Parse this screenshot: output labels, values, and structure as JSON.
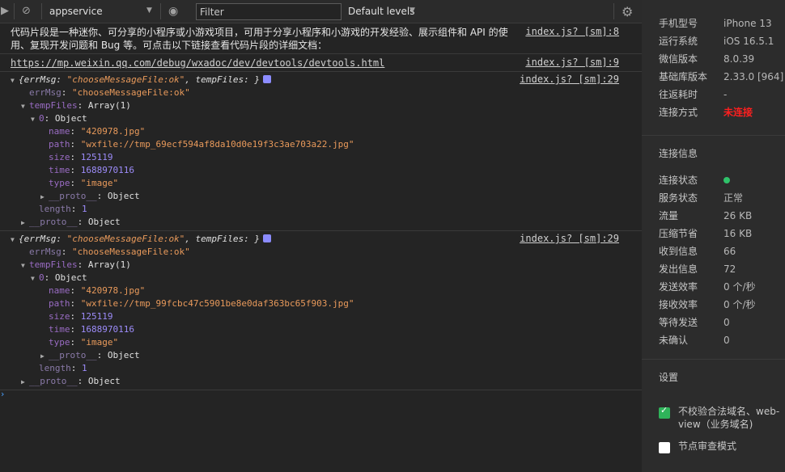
{
  "toolbar": {
    "run_icon": "play-square-icon",
    "clear_icon": "block-icon",
    "context": "appservice",
    "eye_icon": "eye-icon",
    "filter_placeholder": "Filter",
    "levels": "Default levels",
    "settings_icon": "gear-icon"
  },
  "messages": [
    {
      "text": "代码片段是一种迷你、可分享的小程序或小游戏项目，可用于分享小程序和小游戏的开发经验、展示组件和 API 的使用、复现开发问题和 Bug 等。可点击以下链接查看代码片段的详细文档：",
      "source": "index.js? [sm]:8"
    },
    {
      "text": "https://mp.weixin.qq.com/debug/wxadoc/dev/devtools/devtools.html",
      "source": "index.js? [sm]:9"
    }
  ],
  "objects": [
    {
      "summary_prefix": "{errMsg: ",
      "summary_errmsg": "\"chooseMessageFile:ok\"",
      "summary_mid": ", tempFiles: }",
      "source": "index.js? [sm]:29",
      "errMsg_key": "errMsg",
      "errMsg_val": "\"chooseMessageFile:ok\"",
      "tempFiles_key": "tempFiles",
      "tempFiles_val": "Array(1)",
      "item_key": "0",
      "item_val": "Object",
      "name_key": "name",
      "name_val": "\"420978.jpg\"",
      "path_key": "path",
      "path_val": "\"wxfile://tmp_69ecf594af8da10d0e19f3c3ae703a22.jpg\"",
      "size_key": "size",
      "size_val": "125119",
      "time_key": "time",
      "time_val": "1688970116",
      "type_key": "type",
      "type_val": "\"image\"",
      "proto_key": "__proto__",
      "proto_val": "Object",
      "length_key": "length",
      "length_val": "1"
    },
    {
      "summary_prefix": "{errMsg: ",
      "summary_errmsg": "\"chooseMessageFile:ok\"",
      "summary_mid": ", tempFiles: }",
      "source": "index.js? [sm]:29",
      "errMsg_key": "errMsg",
      "errMsg_val": "\"chooseMessageFile:ok\"",
      "tempFiles_key": "tempFiles",
      "tempFiles_val": "Array(1)",
      "item_key": "0",
      "item_val": "Object",
      "name_key": "name",
      "name_val": "\"420978.jpg\"",
      "path_key": "path",
      "path_val": "\"wxfile://tmp_99fcbc47c5901be8e0daf363bc65f903.jpg\"",
      "size_key": "size",
      "size_val": "125119",
      "time_key": "time",
      "time_val": "1688970116",
      "type_key": "type",
      "type_val": "\"image\"",
      "proto_key": "__proto__",
      "proto_val": "Object",
      "length_key": "length",
      "length_val": "1"
    }
  ],
  "prompt_icon": "chevron-right-icon",
  "device": [
    {
      "label": "手机型号",
      "value": "iPhone 13"
    },
    {
      "label": "运行系统",
      "value": "iOS 16.5.1"
    },
    {
      "label": "微信版本",
      "value": "8.0.39"
    },
    {
      "label": "基础库版本",
      "value": "2.33.0 [964]"
    },
    {
      "label": "往返耗时",
      "value": "-"
    },
    {
      "label": "连接方式",
      "value": "未连接"
    }
  ],
  "status_color_unconnected": "#ff1f1f",
  "conn_title": "连接信息",
  "conn": [
    {
      "label": "连接状态",
      "value": ""
    },
    {
      "label": "服务状态",
      "value": "正常"
    },
    {
      "label": "流量",
      "value": "26 KB"
    },
    {
      "label": "压缩节省",
      "value": "16 KB"
    },
    {
      "label": "收到信息",
      "value": "66"
    },
    {
      "label": "发出信息",
      "value": "72"
    },
    {
      "label": "发送效率",
      "value": "0 个/秒"
    },
    {
      "label": "接收效率",
      "value": "0 个/秒"
    },
    {
      "label": "等待发送",
      "value": "0"
    },
    {
      "label": "未确认",
      "value": "0"
    }
  ],
  "status_dot_color": "#2fc26a",
  "settings_title": "设置",
  "settings": {
    "domain_check_line1": "不校验合法域名、web-",
    "domain_check_line2": "view（业务域名)",
    "domain_check_checked": true,
    "node_review": "节点审查模式",
    "node_review_checked": false
  }
}
